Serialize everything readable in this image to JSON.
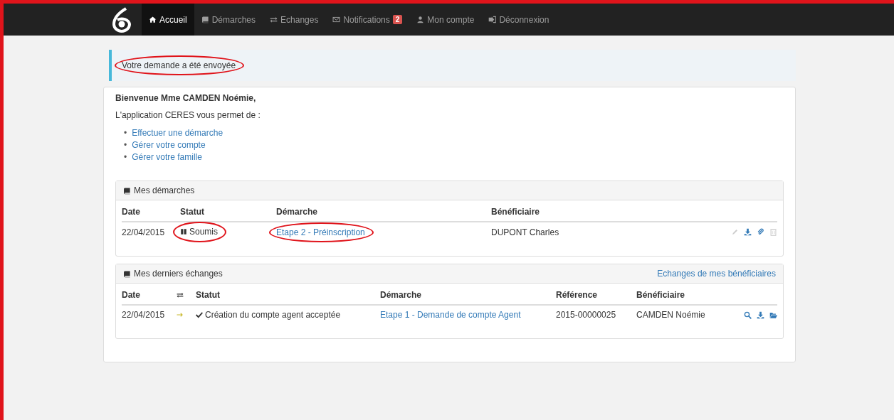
{
  "navbar": {
    "items": [
      {
        "label": "Accueil",
        "kind": "home",
        "selected": true
      },
      {
        "label": "Démarches",
        "kind": "book",
        "selected": false
      },
      {
        "label": "Echanges",
        "kind": "exchange",
        "selected": false
      },
      {
        "label": "Notifications",
        "kind": "envelope",
        "selected": false,
        "badge": "2"
      },
      {
        "label": "Mon compte",
        "kind": "user",
        "selected": false
      },
      {
        "label": "Déconnexion",
        "kind": "signout",
        "selected": false
      }
    ]
  },
  "notice": {
    "text": "Votre demande a été envoyée",
    "circled": true
  },
  "welcome": {
    "title": "Bienvenue Mme CAMDEN Noémie,",
    "intro": "L'application CERES vous permet de :",
    "links": [
      {
        "bullet": "•",
        "text": "Effectuer une démarche"
      },
      {
        "bullet": "•",
        "text": "Gérer votre compte"
      },
      {
        "bullet": "•",
        "text": "Gérer votre famille"
      }
    ]
  },
  "demarches": {
    "title": "Mes démarches",
    "columns": [
      "Date",
      "Statut",
      "Démarche",
      "Bénéficiaire"
    ],
    "rows": [
      {
        "date": "22/04/2015",
        "status": "Soumis",
        "status_circled": true,
        "demarche": "Etape 2 - Préinscription",
        "demarche_circled": true,
        "beneficiaire": "DUPONT Charles",
        "actions": [
          {
            "kind": "edit",
            "disabled": true
          },
          {
            "kind": "download",
            "disabled": false
          },
          {
            "kind": "attach",
            "disabled": false
          },
          {
            "kind": "delete",
            "disabled": true
          }
        ]
      }
    ]
  },
  "echanges": {
    "title": "Mes derniers échanges",
    "link": "Echanges de mes bénéficiaires",
    "columns": [
      "Date",
      "Statut",
      "Démarche",
      "Référence",
      "Bénéficiaire"
    ],
    "rows": [
      {
        "date": "22/04/2015",
        "status": "Création du compte agent acceptée",
        "demarche": "Etape 1 - Demande de compte Agent",
        "reference": "2015-00000025",
        "beneficiaire": "CAMDEN Noémie",
        "actions": [
          {
            "kind": "search",
            "disabled": false
          },
          {
            "kind": "download",
            "disabled": false
          },
          {
            "kind": "folder",
            "disabled": false
          }
        ]
      }
    ]
  }
}
